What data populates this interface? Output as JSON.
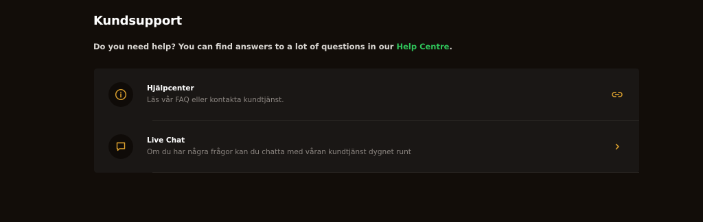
{
  "support": {
    "title": "Kundsupport",
    "intro_text": "Do you need help? You can find answers to a lot of questions in our ",
    "intro_link": "Help Centre",
    "intro_suffix": "."
  },
  "items": [
    {
      "title": "Hjälpcenter",
      "subtitle": "Läs vår FAQ eller kontakta kundtjänst.",
      "icon": "info-icon",
      "trailing_icon": "link-icon"
    },
    {
      "title": "Live Chat",
      "subtitle": "Om du har några frågor kan du chatta med våran kundtjänst dygnet runt",
      "icon": "chat-icon",
      "trailing_icon": "chevron-right-icon"
    }
  ],
  "colors": {
    "background": "#120d09",
    "card": "#1a1715",
    "accent": "#e3a62f",
    "link": "#2fc45a"
  }
}
